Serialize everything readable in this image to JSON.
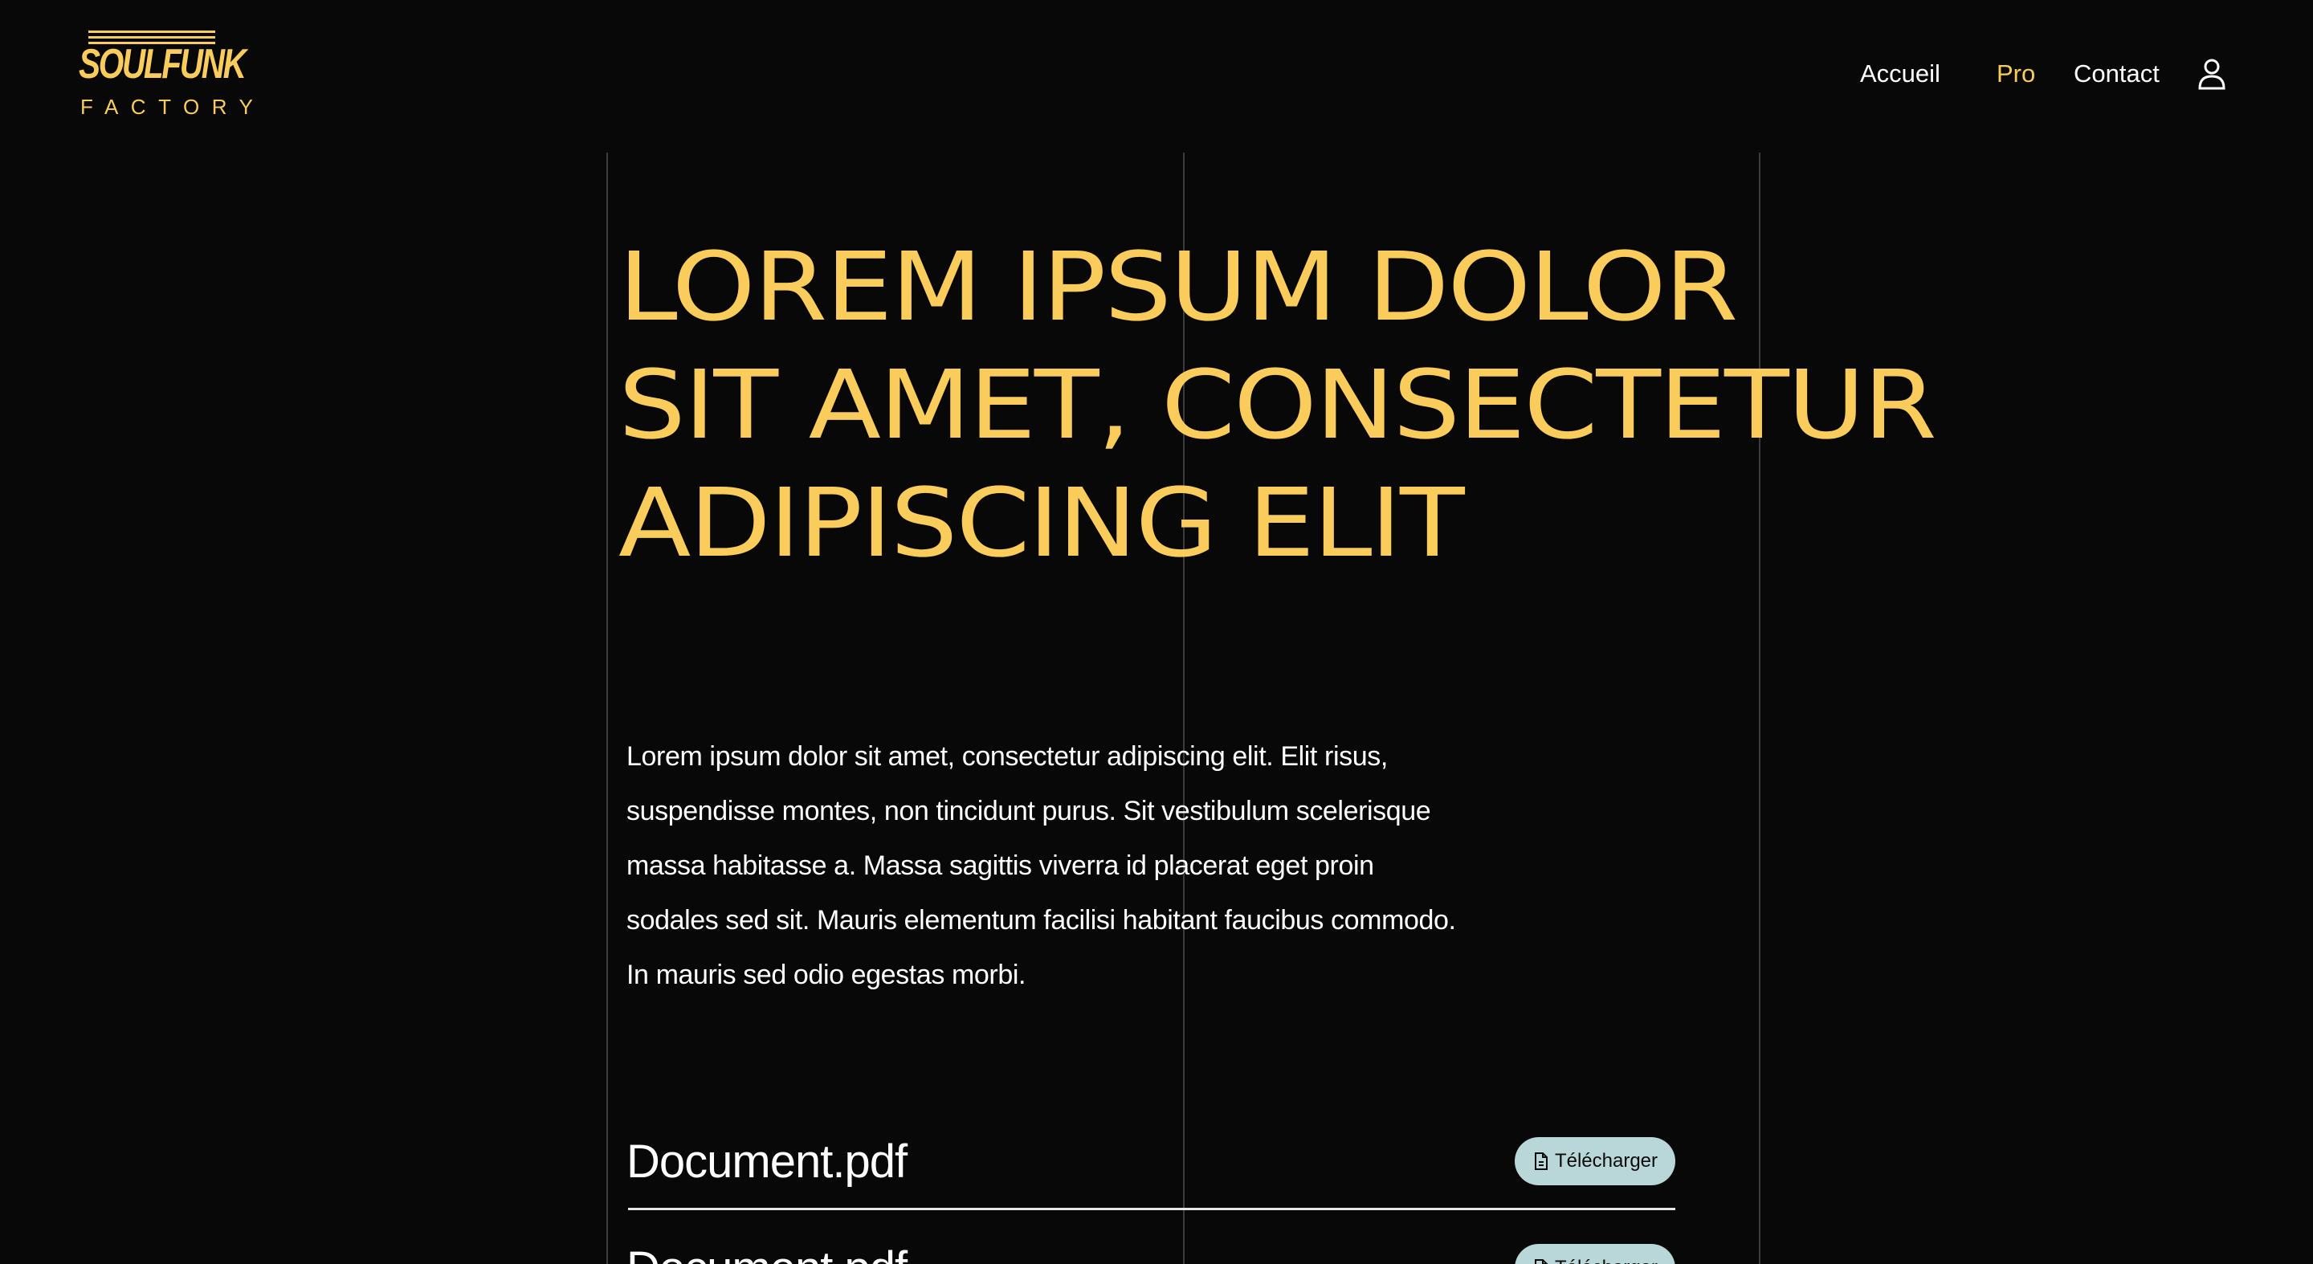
{
  "brand": {
    "name": "SOULFUNK",
    "subtitle": "FACTORY",
    "accent_color": "#f9cc5c"
  },
  "nav": {
    "items": [
      {
        "label": "Accueil",
        "active": false
      },
      {
        "label": "Pro",
        "active": true
      },
      {
        "label": "Contact",
        "active": false
      }
    ],
    "user_icon": "user-icon"
  },
  "hero": {
    "title_lines": [
      "LOREM IPSUM DOLOR",
      "SIT AMET, CONSECTETUR",
      "ADIPISCING ELIT"
    ]
  },
  "intro": {
    "lines": [
      "Lorem ipsum dolor sit amet, consectetur adipiscing elit. Elit risus,",
      "suspendisse montes, non tincidunt purus. Sit vestibulum scelerisque",
      "massa habitasse a. Massa sagittis viverra id placerat eget proin",
      "sodales sed sit. Mauris elementum facilisi habitant faucibus commodo.",
      "In mauris sed odio egestas morbi."
    ]
  },
  "documents": [
    {
      "name": "Document.pdf",
      "button_label": "Télécharger",
      "icon": "file-icon"
    },
    {
      "name": "Document.pdf",
      "button_label": "Télécharger",
      "icon": "file-icon"
    }
  ],
  "colors": {
    "background": "#080808",
    "text": "#ffffff",
    "button_bg": "#b9d6d8",
    "grid_line": "#3c3c3c"
  }
}
